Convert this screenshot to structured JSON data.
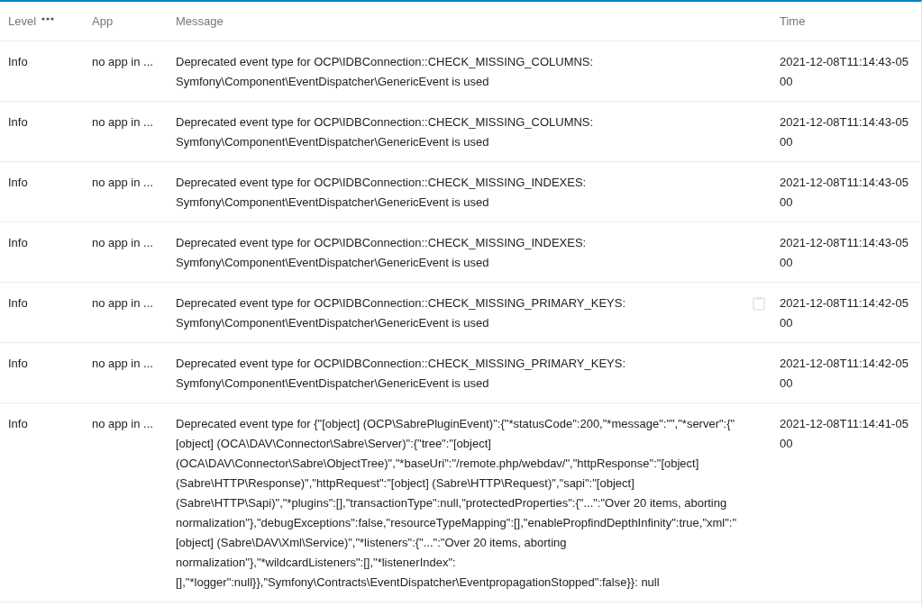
{
  "table": {
    "columns": [
      {
        "label": "Level",
        "kind": "menu"
      },
      {
        "label": "App",
        "kind": "plain"
      },
      {
        "label": "Message",
        "kind": "plain"
      },
      {
        "label": "Time",
        "kind": "plain"
      }
    ],
    "rows": [
      {
        "level": "Info",
        "app": "no app in ...",
        "message": "Deprecated event type for OCP\\IDBConnection::CHECK_MISSING_COLUMNS: Symfony\\Component\\EventDispatcher\\GenericEvent is used",
        "time": "2021-12-08T11:14:43-0500",
        "hovered": false
      },
      {
        "level": "Info",
        "app": "no app in ...",
        "message": "Deprecated event type for OCP\\IDBConnection::CHECK_MISSING_COLUMNS: Symfony\\Component\\EventDispatcher\\GenericEvent is used",
        "time": "2021-12-08T11:14:43-0500",
        "hovered": false
      },
      {
        "level": "Info",
        "app": "no app in ...",
        "message": "Deprecated event type for OCP\\IDBConnection::CHECK_MISSING_INDEXES: Symfony\\Component\\EventDispatcher\\GenericEvent is used",
        "time": "2021-12-08T11:14:43-0500",
        "hovered": false
      },
      {
        "level": "Info",
        "app": "no app in ...",
        "message": "Deprecated event type for OCP\\IDBConnection::CHECK_MISSING_INDEXES: Symfony\\Component\\EventDispatcher\\GenericEvent is used",
        "time": "2021-12-08T11:14:43-0500",
        "hovered": false
      },
      {
        "level": "Info",
        "app": "no app in ...",
        "message": "Deprecated event type for OCP\\IDBConnection::CHECK_MISSING_PRIMARY_KEYS: Symfony\\Component\\EventDispatcher\\GenericEvent is used",
        "time": "2021-12-08T11:14:42-0500",
        "hovered": true
      },
      {
        "level": "Info",
        "app": "no app in ...",
        "message": "Deprecated event type for OCP\\IDBConnection::CHECK_MISSING_PRIMARY_KEYS: Symfony\\Component\\EventDispatcher\\GenericEvent is used",
        "time": "2021-12-08T11:14:42-0500",
        "hovered": false
      },
      {
        "level": "Info",
        "app": "no app in ...",
        "message": "Deprecated event type for {\"[object] (OCP\\SabrePluginEvent)\":{\"*statusCode\":200,\"*message\":\"\",\"*server\":{\"[object] (OCA\\DAV\\Connector\\Sabre\\Server)\":{\"tree\":\"[object] (OCA\\DAV\\Connector\\Sabre\\ObjectTree)\",\"*baseUri\":\"/remote.php/webdav/\",\"httpResponse\":\"[object] (Sabre\\HTTP\\Response)\",\"httpRequest\":\"[object] (Sabre\\HTTP\\Request)\",\"sapi\":\"[object] (Sabre\\HTTP\\Sapi)\",\"*plugins\":[],\"transactionType\":null,\"protectedProperties\":{\"...\":\"Over 20 items, aborting normalization\"},\"debugExceptions\":false,\"resourceTypeMapping\":[],\"enablePropfindDepthInfinity\":true,\"xml\":\"[object] (Sabre\\DAV\\Xml\\Service)\",\"*listeners\":{\"...\":\"Over 20 items, aborting normalization\"},\"*wildcardListeners\":[],\"*listenerIndex\":[],\"*logger\":null}},\"Symfony\\Contracts\\EventDispatcher\\EventpropagationStopped\":false}}: null",
        "time": "2021-12-08T11:14:41-0500",
        "hovered": false
      }
    ]
  }
}
